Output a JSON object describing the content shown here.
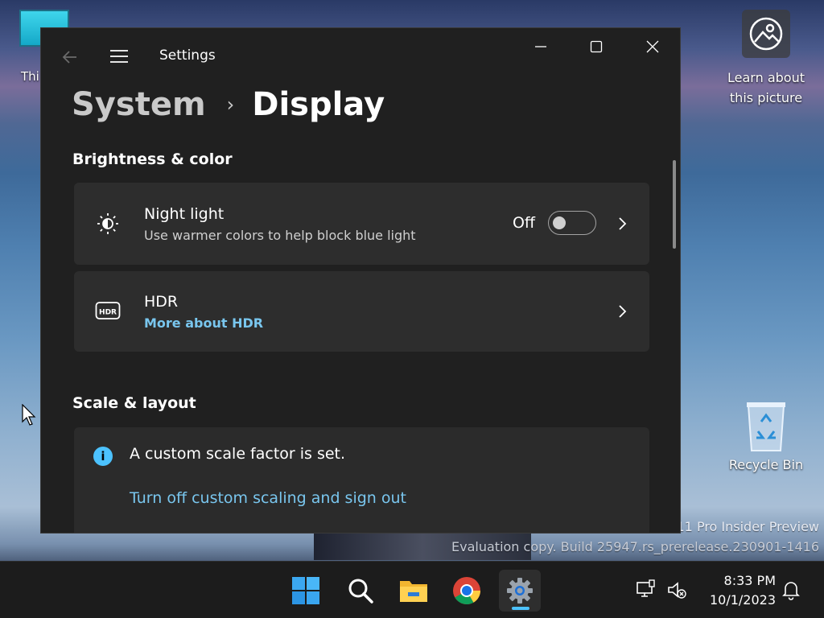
{
  "desktop": {
    "this_pc_label": "Thi",
    "learn_label_1": "Learn about",
    "learn_label_2": "this picture",
    "recycle_label": "Recycle Bin",
    "watermark_line1": "11 Pro Insider Preview",
    "watermark_line2": "Evaluation copy. Build 25947.rs_prerelease.230901-1416"
  },
  "window": {
    "title": "Settings",
    "breadcrumb": {
      "parent": "System",
      "separator": "›",
      "current": "Display"
    }
  },
  "brightness_section": {
    "title": "Brightness & color",
    "night_light": {
      "title": "Night light",
      "description": "Use warmer colors to help block blue light",
      "state_label": "Off",
      "toggle_on": false,
      "icon": "night-light-icon"
    },
    "hdr": {
      "title": "HDR",
      "link": "More about HDR",
      "icon": "hdr-icon"
    }
  },
  "scale_section": {
    "title": "Scale & layout",
    "info_text": "A custom scale factor is set.",
    "info_link": "Turn off custom scaling and sign out"
  },
  "taskbar": {
    "apps": [
      "start",
      "search",
      "file-explorer",
      "chrome",
      "settings"
    ],
    "time": "8:33 PM",
    "date": "10/1/2023"
  },
  "colors": {
    "accent": "#4cc2ff",
    "link": "#79c6ee",
    "card": "#2d2d2d",
    "window": "#202020"
  }
}
